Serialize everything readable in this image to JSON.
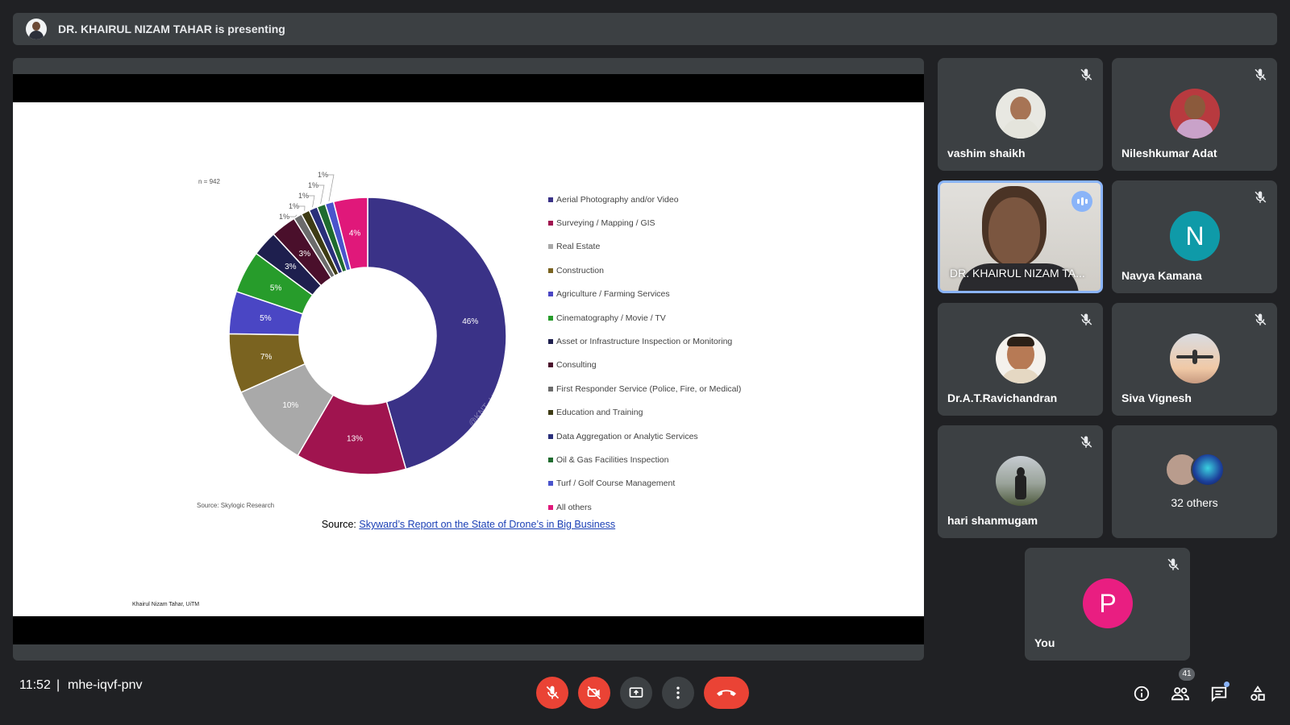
{
  "topbar": {
    "presenting_text": "DR. KHAIRUL NIZAM TAHAR is presenting"
  },
  "slide": {
    "n_label": "n = 942",
    "source_note": "Source: Skylogic Research",
    "watermark": "@KNT_UiTM",
    "source_prefix": "Source: ",
    "source_link": "Skyward’s Report on the State of Drone’s in Big Business",
    "author": "Khairul Nizam Tahar, UiTM"
  },
  "chart_data": {
    "type": "pie",
    "donut": true,
    "categories": [
      "Aerial Photography and/or Video",
      "Surveying / Mapping / GIS",
      "Real Estate",
      "Construction",
      "Agriculture / Farming Services",
      "Cinematography / Movie / TV",
      "Asset or Infrastructure Inspection or Monitoring",
      "Consulting",
      "First Responder Service (Police, Fire, or Medical)",
      "Education and Training",
      "Data Aggregation or Analytic Services",
      "Oil & Gas Facilities Inspection",
      "Turf / Golf Course Management",
      "All others"
    ],
    "values": [
      46,
      13,
      10,
      7,
      5,
      5,
      3,
      3,
      1,
      1,
      1,
      1,
      1,
      4
    ],
    "labels": [
      "46%",
      "13%",
      "10%",
      "7%",
      "5%",
      "5%",
      "3%",
      "3%",
      "1%",
      "1%",
      "1%",
      "1%",
      "1%",
      "4%"
    ],
    "colors": [
      "#3a3287",
      "#a0144f",
      "#a9a9a9",
      "#7a6320",
      "#4a46c4",
      "#279c2b",
      "#1e1f4e",
      "#4a0f2b",
      "#6b6b6b",
      "#3e3b14",
      "#2a2f7a",
      "#1f6b2f",
      "#4a54cc",
      "#e0187a"
    ],
    "legend_position": "right"
  },
  "tiles": [
    {
      "name": "vashim shaikh"
    },
    {
      "name": "Nileshkumar Adat"
    },
    {
      "name": "DR. KHAIRUL NIZAM TA..."
    },
    {
      "name": "Navya Kamana",
      "initial": "N"
    },
    {
      "name": "Dr.A.T.Ravichandran"
    },
    {
      "name": "Siva Vignesh"
    },
    {
      "name": "hari shanmugam"
    },
    {
      "name": "32 others"
    },
    {
      "name": "You",
      "initial": "P"
    }
  ],
  "bottom": {
    "time": "11:52",
    "separator": "|",
    "meeting_code": "mhe-iqvf-pnv",
    "participants_count": "41"
  },
  "colors": {
    "accent": "#8ab4f8",
    "danger": "#ea4335",
    "surface": "#3c4043",
    "background": "#202124"
  },
  "icons": [
    "mic-off-icon",
    "camera-off-icon",
    "present-icon",
    "more-options-icon",
    "hang-up-icon",
    "info-icon",
    "people-icon",
    "chat-icon",
    "activities-icon"
  ]
}
